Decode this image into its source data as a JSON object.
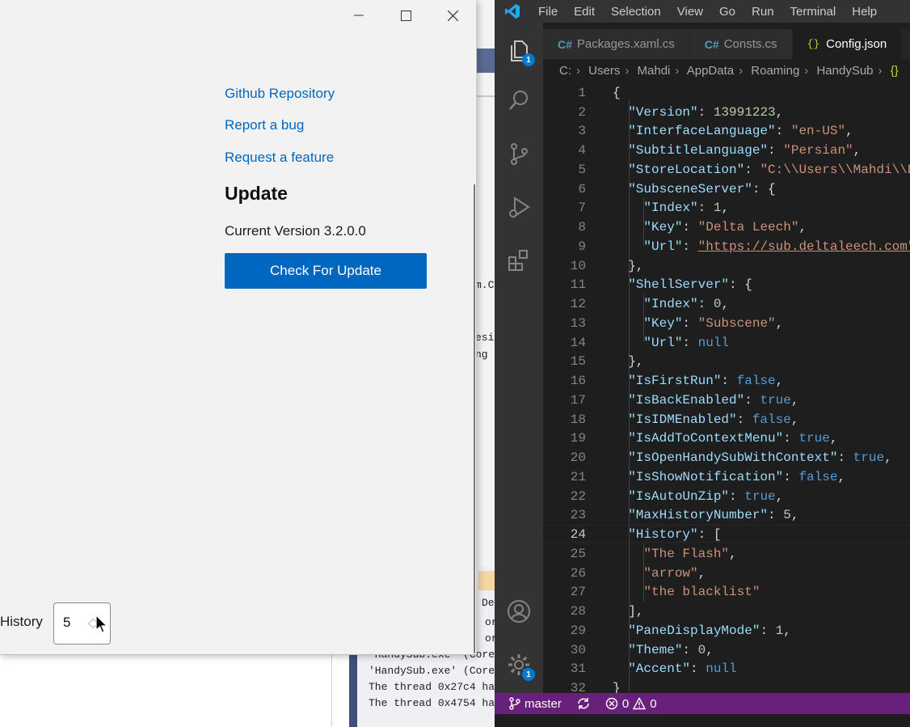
{
  "handysub": {
    "links": [
      "Github Repository",
      "Report a bug",
      "Request a feature"
    ],
    "update_title": "Update",
    "current_version": "Current Version 3.2.0.0",
    "check_button": "Check For Update",
    "history_label": "History",
    "history_value": "5",
    "accent_color": "#0067c0"
  },
  "background": {
    "output_lines": [
      "'HandySub.exe' (Core",
      "'HandySub.exe' (Core",
      "The thread 0x27c4 ha",
      "The thread 0x4754 ha"
    ],
    "output_debug": "Deb",
    "output_partial": [
      "ore",
      "ore"
    ],
    "code_fragments": [
      "m.C",
      "esi",
      "ng"
    ]
  },
  "vscode": {
    "menu": [
      "File",
      "Edit",
      "Selection",
      "View",
      "Go",
      "Run",
      "Terminal",
      "Help"
    ],
    "tabs": [
      {
        "label": "Packages.xaml.cs",
        "icon": "C#"
      },
      {
        "label": "Consts.cs",
        "icon": "C#"
      },
      {
        "label": "Config.json",
        "icon": "{}"
      }
    ],
    "breadcrumb": [
      "C:",
      "Users",
      "Mahdi",
      "AppData",
      "Roaming",
      "HandySub",
      "{}"
    ],
    "explorer_badge": "1",
    "settings_badge": "1",
    "line_numbers": [
      "1",
      "2",
      "3",
      "4",
      "5",
      "6",
      "7",
      "8",
      "9",
      "10",
      "11",
      "12",
      "13",
      "14",
      "15",
      "16",
      "17",
      "18",
      "19",
      "20",
      "21",
      "22",
      "23",
      "24",
      "25",
      "26",
      "27",
      "28",
      "29",
      "30",
      "31",
      "32"
    ],
    "json": {
      "version": "13991223",
      "interface_language": "\"en-US\"",
      "subtitle_language": "\"Persian\"",
      "store_location": "\"C:\\\\Users\\\\Mahdi\\\\D",
      "subscene_index": "1",
      "subscene_key": "\"Delta Leech\"",
      "subscene_url": "\"https://sub.deltaleech.com\"",
      "shell_index": "0",
      "shell_key": "\"Subscene\"",
      "shell_url": "null",
      "is_first_run": "false",
      "is_back_enabled": "true",
      "is_idm_enabled": "false",
      "is_add_to_context_menu": "true",
      "is_open_with_context": "true",
      "is_show_notification": "false",
      "is_auto_unzip": "true",
      "max_history": "5",
      "history": [
        "\"The Flash\"",
        "\"arrow\"",
        "\"the blacklist\""
      ],
      "pane_display_mode": "1",
      "theme": "0",
      "accent": "null"
    },
    "status": {
      "branch": "master",
      "errors": "0",
      "warnings": "0"
    },
    "colors": {
      "status_bar": "#68217a",
      "editor_bg": "#1e1e1e",
      "key": "#9cdcfe",
      "string": "#ce9178",
      "number": "#b5cea8",
      "keyword": "#569cd6"
    }
  }
}
